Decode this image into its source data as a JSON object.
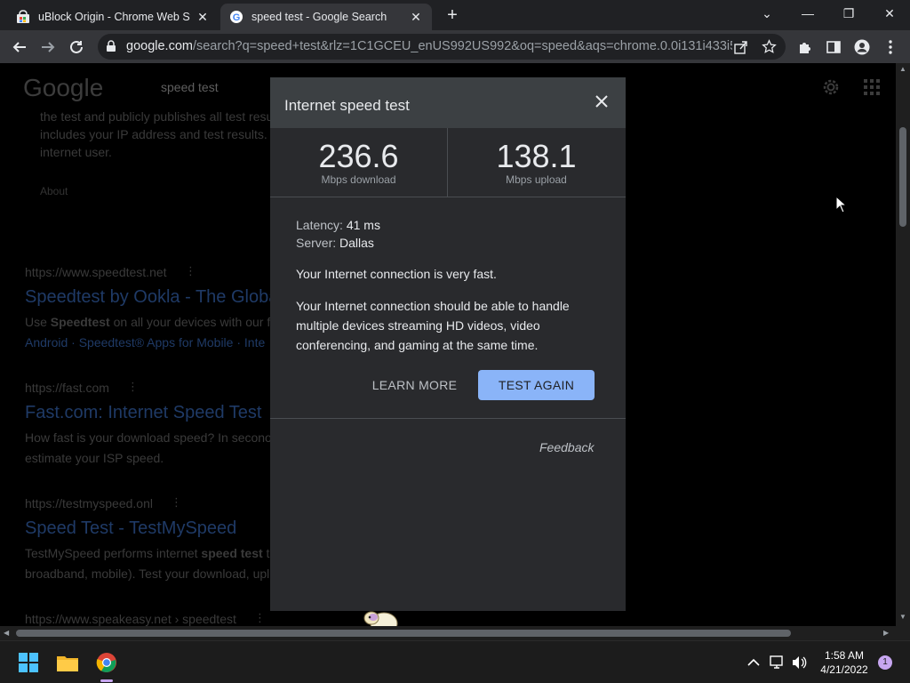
{
  "browser": {
    "tabs": [
      {
        "title": "uBlock Origin - Chrome Web Store",
        "active": false
      },
      {
        "title": "speed test - Google Search",
        "active": true
      }
    ],
    "url_host": "google.com",
    "url_rest": "/search?q=speed+test&rlz=1C1GCEU_enUS992US992&oq=speed&aqs=chrome.0.0i131i433i51...",
    "accent": "#8ab4f8"
  },
  "background": {
    "logo": "Google",
    "query": "speed test",
    "snippet_lines": [
      "the test and publicly publishes all test resu",
      "includes your IP address and test results.",
      "internet user."
    ],
    "about": "About",
    "results": [
      {
        "url": "https://www.speedtest.net",
        "title": "Speedtest by Ookla - The Globa",
        "desc1_pre": "Use ",
        "desc1_bold": "Speedtest",
        "desc1_post": " on all your devices with our fr",
        "desc2": "Android · Speedtest® Apps for Mobile · Inte"
      },
      {
        "url": "https://fast.com",
        "title": "Fast.com: Internet Speed Test",
        "desc1_pre": "How fast is your download speed? In secono",
        "desc1_bold": "",
        "desc1_post": "",
        "desc2": "estimate your ISP speed."
      },
      {
        "url": "https://testmyspeed.onl",
        "title": "Speed Test - TestMySpeed",
        "desc1_pre": "TestMySpeed performs internet ",
        "desc1_bold": "speed test",
        "desc1_post": " to",
        "desc2": "broadband, mobile). Test your download, upl"
      }
    ],
    "partial_url": "https://www.speakeasy.net › speedtest"
  },
  "modal": {
    "title": "Internet speed test",
    "download_value": "236.6",
    "download_unit": "Mbps download",
    "upload_value": "138.1",
    "upload_unit": "Mbps upload",
    "latency_label": "Latency:",
    "latency_value": "41 ms",
    "server_label": "Server:",
    "server_value": "Dallas",
    "message_1": "Your Internet connection is very fast.",
    "message_2": "Your Internet connection should be able to handle multiple devices streaming HD videos, video conferencing, and gaming at the same time.",
    "learn_more": "LEARN MORE",
    "test_again": "TEST AGAIN",
    "feedback": "Feedback"
  },
  "taskbar": {
    "time": "1:58 AM",
    "date": "4/21/2022",
    "notification_count": "1"
  }
}
